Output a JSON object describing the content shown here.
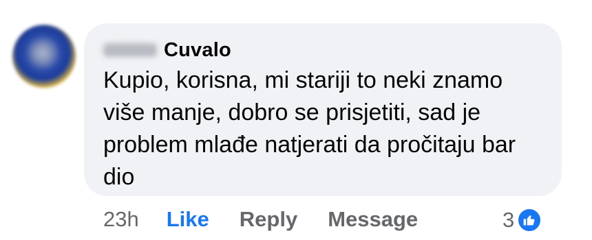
{
  "comment": {
    "author_name": "Cuvalo",
    "text": "Kupio, korisna, mi stariji to neki znamo\nviše manje, dobro se prisjetiti, sad je\nproblem mlađe natjerati da pročitaju bar\ndio"
  },
  "actions": {
    "timestamp": "23h",
    "like_label": "Like",
    "reply_label": "Reply",
    "message_label": "Message"
  },
  "reactions": {
    "count": "3",
    "icon": "like-icon",
    "color": "#1877f2"
  },
  "colors": {
    "bubble": "#f0f2f5",
    "text": "#050505",
    "secondary": "#65676b",
    "accent": "#1877f2"
  }
}
